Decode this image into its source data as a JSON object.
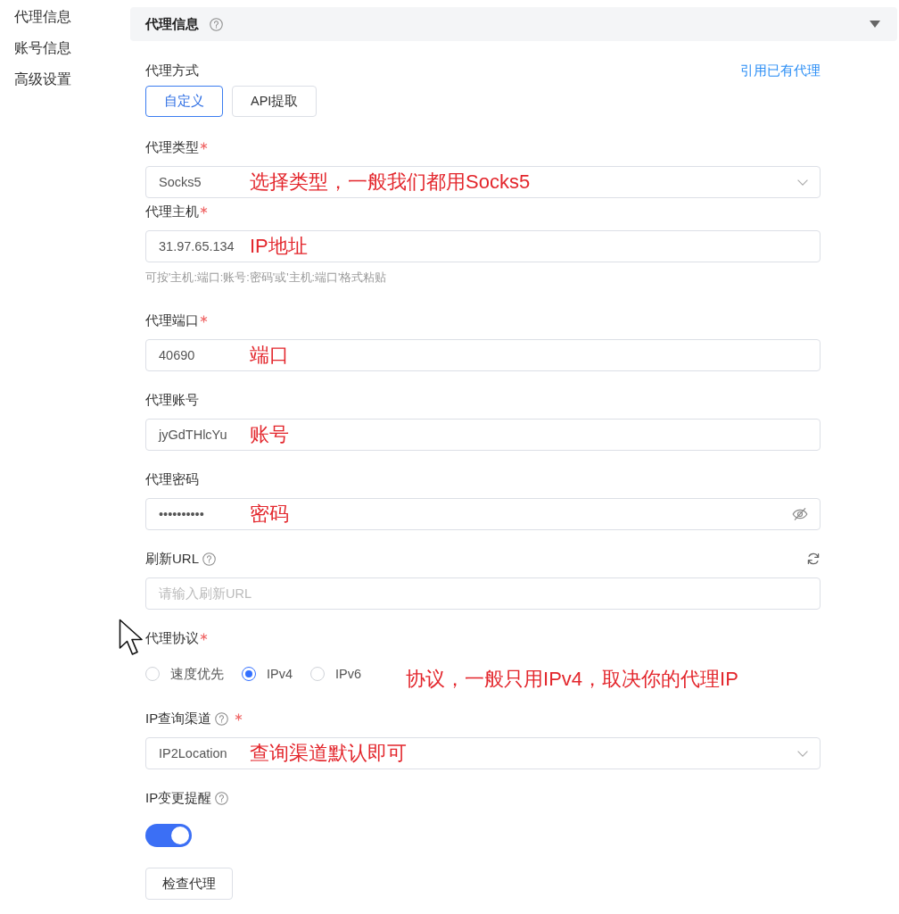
{
  "sidebar": {
    "items": [
      {
        "label": "代理信息"
      },
      {
        "label": "账号信息"
      },
      {
        "label": "高级设置"
      }
    ]
  },
  "section": {
    "title": "代理信息",
    "help": true,
    "expanded": true
  },
  "form": {
    "mode": {
      "label": "代理方式",
      "link": "引用已有代理",
      "options": [
        {
          "label": "自定义",
          "selected": true
        },
        {
          "label": "API提取",
          "selected": false
        }
      ]
    },
    "fields": [
      {
        "kind": "select",
        "label": "代理类型",
        "required": true,
        "help": false,
        "value": "Socks5",
        "annotation": "选择类型，一般我们都用Socks5"
      },
      {
        "kind": "input",
        "label": "代理主机",
        "required": true,
        "help": false,
        "value": "31.97.65.134",
        "annotation": "IP地址",
        "hint": "可按'主机:端口:账号:密码'或'主机:端口'格式粘贴"
      },
      {
        "kind": "input",
        "label": "代理端口",
        "required": true,
        "help": false,
        "value": "40690",
        "annotation": "端口"
      },
      {
        "kind": "input",
        "label": "代理账号",
        "required": false,
        "help": false,
        "value": "jyGdTHlcYu",
        "annotation": "账号"
      },
      {
        "kind": "password",
        "label": "代理密码",
        "required": false,
        "help": false,
        "value": "••••••••••",
        "annotation": "密码"
      },
      {
        "kind": "input",
        "label": "刷新URL",
        "required": false,
        "help": true,
        "refreshable": true,
        "placeholder": "请输入刷新URL"
      },
      {
        "kind": "radio",
        "label": "代理协议",
        "required": true,
        "help": false,
        "options": [
          {
            "label": "速度优先",
            "selected": false
          },
          {
            "label": "IPv4",
            "selected": true
          },
          {
            "label": "IPv6",
            "selected": false
          }
        ],
        "annotation": "协议，一般只用IPv4，取决你的代理IP"
      },
      {
        "kind": "select",
        "label": "IP查询渠道",
        "required": true,
        "help": true,
        "value": "IP2Location",
        "annotation": "查询渠道默认即可"
      },
      {
        "kind": "switch",
        "label": "IP变更提醒",
        "required": false,
        "help": true,
        "on": true
      }
    ],
    "button": "检查代理"
  }
}
